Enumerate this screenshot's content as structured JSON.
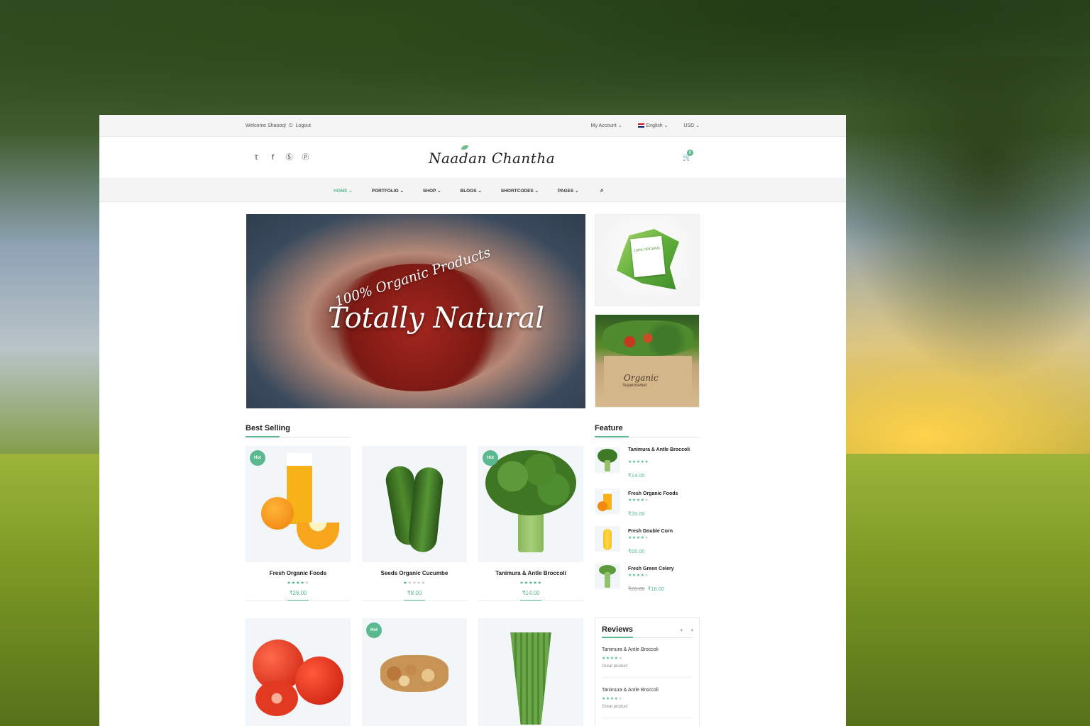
{
  "topbar": {
    "welcome": "Welcome Shaooq!",
    "logout": "Logout",
    "my_account": "My Account ⌄",
    "language": "English ⌄",
    "currency": "USD ⌄"
  },
  "header": {
    "logo": "Naadan Chantha",
    "cart_count": "0"
  },
  "nav": {
    "items": [
      "HOME ⌄",
      "PORTFOLIO ⌄",
      "SHOP ⌄",
      "BLOGS ⌄",
      "SHORTCODES ⌄",
      "PAGES ⌄"
    ],
    "active_index": 0
  },
  "hero": {
    "line1": "100% Organic Products",
    "line2": "Totally Natural"
  },
  "side_banners": {
    "card_text": "100% ORGANIC",
    "box_brand": "Organic",
    "box_sub": "Supermarket"
  },
  "best_selling": {
    "title": "Best Selling",
    "hot_label": "Hot",
    "products": [
      {
        "name": "Fresh Organic Foods",
        "rating": 4,
        "price": "₹26.00",
        "hot": true
      },
      {
        "name": "Seeds Organic Cucumbe",
        "rating": 1,
        "price": "₹8.00",
        "hot": false
      },
      {
        "name": "Tanimura & Antle Broccoli",
        "rating": 4.5,
        "price": "₹14.00",
        "hot": true
      },
      {
        "name": "",
        "rating": 0,
        "price": "",
        "hot": false
      },
      {
        "name": "",
        "rating": 0,
        "price": "",
        "hot": true
      },
      {
        "name": "",
        "rating": 0,
        "price": "",
        "hot": false
      }
    ]
  },
  "feature": {
    "title": "Feature",
    "items": [
      {
        "name": "Tanimura & Antle Broccoli",
        "rating": 4.5,
        "price": "₹14.00",
        "old_price": ""
      },
      {
        "name": "Fresh Organic Foods",
        "rating": 4,
        "price": "₹26.00",
        "old_price": ""
      },
      {
        "name": "Fresh Double Corn",
        "rating": 4,
        "price": "₹65.00",
        "old_price": ""
      },
      {
        "name": "Fresh Green Celery",
        "rating": 4,
        "price": "₹18.00",
        "old_price": "₹20.00"
      }
    ]
  },
  "reviews": {
    "title": "Reviews",
    "prev": "‹",
    "next": "›",
    "items": [
      {
        "product": "Tanimura & Antle Broccoli",
        "rating": 4,
        "comment": "Great product"
      },
      {
        "product": "Tanimura & Antle Broccoli",
        "rating": 4,
        "comment": "Great product"
      }
    ]
  },
  "colors": {
    "accent": "#5bb98f",
    "topbar_bg": "#f5f5f5",
    "card_bg": "#f2f6f8"
  },
  "icons": {
    "social": [
      "twitter-icon",
      "facebook-icon",
      "skype-icon",
      "pinterest-icon"
    ],
    "cart": "cart-icon",
    "search": "search-icon"
  }
}
